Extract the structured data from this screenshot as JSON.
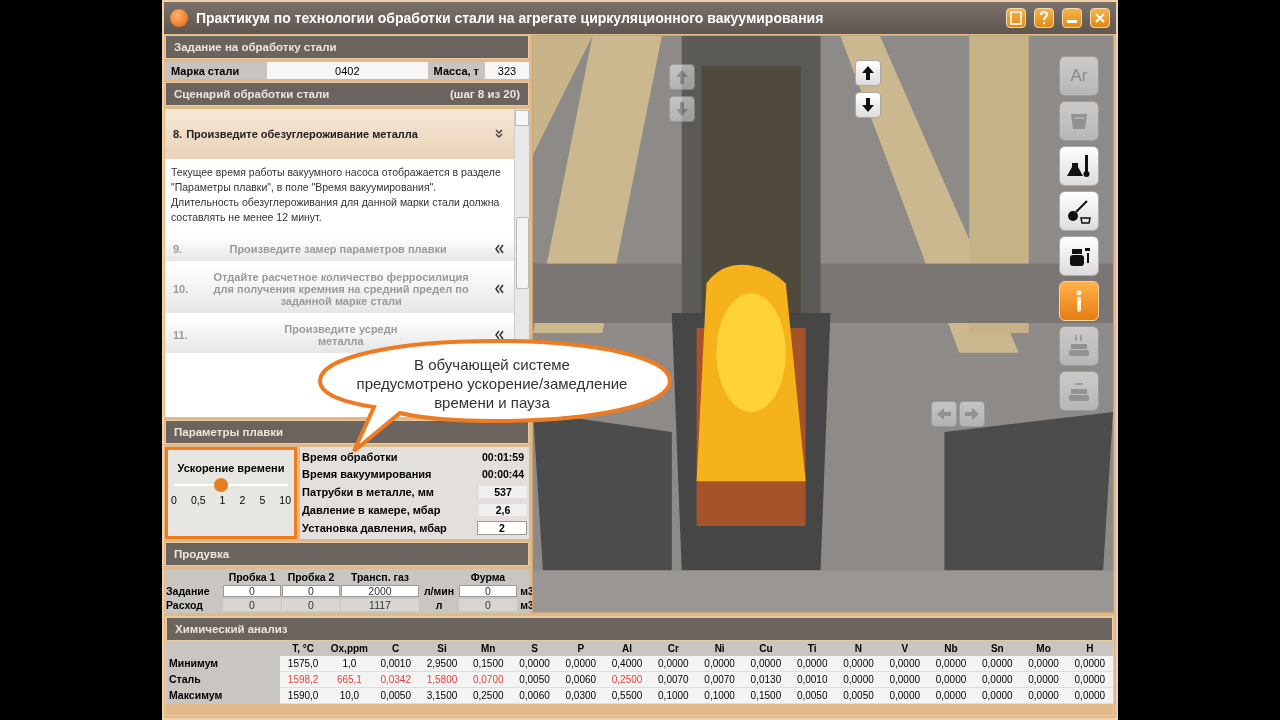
{
  "window": {
    "title": "Практикум по технологии обработки стали на агрегате циркуляционного вакуумирования"
  },
  "task": {
    "header": "Задание на обработку стали",
    "fields": [
      {
        "label": "Марка стали",
        "value": "0402"
      },
      {
        "label": "Масса, т",
        "value": "323"
      }
    ]
  },
  "scenario": {
    "header": "Сценарий обработки стали",
    "step_info": "(шаг 8 из 20)",
    "steps": [
      {
        "number": "8.",
        "lines": [
          "Произведите обезуглероживание металла"
        ],
        "expanded": true,
        "description": [
          "Текущее время работы вакуумного насоса отображается в разделе \"Параметры плавки\", в поле \"Время вакуумирования\".",
          "Длительность обезуглероживания для данной марки стали должна составлять не менее 12 минут."
        ]
      },
      {
        "number": "9.",
        "lines": [
          "Произведите замер параметров плавки"
        ],
        "expanded": false
      },
      {
        "number": "10.",
        "lines": [
          "Отдайте расчетное количество ферросилиция",
          "для получения кремния на средний предел по",
          "заданной марке стали"
        ],
        "expanded": false
      },
      {
        "number": "11.",
        "lines": [
          "Произведите усредн",
          "металла"
        ],
        "expanded": false
      }
    ]
  },
  "params": {
    "header": "Параметры плавки",
    "speed": {
      "label": "Ускорение времени",
      "ticks": [
        "0",
        "0,5",
        "1",
        "2",
        "5",
        "10"
      ],
      "level": 0.4,
      "highlighted": true
    },
    "readings": [
      {
        "label": "Время обработки",
        "value": "00:01:59",
        "kind": "readout"
      },
      {
        "label": "Время вакуумирования",
        "value": "00:00:44",
        "kind": "readout"
      },
      {
        "label": "Патрубки в металле, мм",
        "value": "537",
        "kind": "box"
      },
      {
        "label": "Давление в камере, мбар",
        "value": "2,6",
        "kind": "box"
      },
      {
        "label": "Установка давления, мбар",
        "value": "2",
        "kind": "input"
      }
    ]
  },
  "blowing": {
    "header": "Продувка",
    "columns": [
      "Пробка 1",
      "Пробка 2",
      "Трансп. газ",
      "",
      "Фурма",
      ""
    ],
    "rows": [
      {
        "label": "Задание",
        "editable": true,
        "cells": [
          "0",
          "0",
          "2000",
          "л/мин",
          "0",
          "м3"
        ]
      },
      {
        "label": "Расход",
        "editable": false,
        "cells": [
          "0",
          "0",
          "1117",
          "л",
          "0",
          "м3"
        ]
      }
    ]
  },
  "viewport": {
    "kind": "picture",
    "tools": [
      {
        "kind": "text",
        "label": "Ar",
        "disabled": true,
        "selected": false
      },
      {
        "kind": "ladle",
        "disabled": true,
        "selected": false
      },
      {
        "kind": "flask",
        "disabled": false,
        "selected": false
      },
      {
        "kind": "shovel",
        "disabled": false,
        "selected": false
      },
      {
        "kind": "pump",
        "disabled": false,
        "selected": false
      },
      {
        "kind": "info",
        "disabled": false,
        "selected": true
      },
      {
        "kind": "ladle-up",
        "disabled": true,
        "selected": false
      },
      {
        "kind": "ladle-side",
        "disabled": true,
        "selected": false
      }
    ],
    "lift_left": [
      {
        "kind": "up",
        "disabled": true
      },
      {
        "kind": "down",
        "disabled": true
      }
    ],
    "lift_right": [
      {
        "kind": "up",
        "disabled": false
      },
      {
        "kind": "down",
        "disabled": false
      }
    ],
    "cart": [
      {
        "kind": "left",
        "disabled": true
      },
      {
        "kind": "right",
        "disabled": true
      }
    ]
  },
  "callout": {
    "lines": [
      "В обучающей системе",
      "предусмотрено ускорение/замедление",
      "времени и пауза"
    ]
  },
  "chemistry": {
    "header": "Химический анализ",
    "columns": [
      "T, °C",
      "Ox,ppm",
      "C",
      "Si",
      "Mn",
      "S",
      "P",
      "Al",
      "Cr",
      "Ni",
      "Cu",
      "Ti",
      "N",
      "V",
      "Nb",
      "Sn",
      "Mo",
      "H"
    ],
    "rows": [
      {
        "label": "Минимум",
        "values": [
          "1575,0",
          "1,0",
          "0,0010",
          "2,9500",
          "0,1500",
          "0,0000",
          "0,0000",
          "0,4000",
          "0,0000",
          "0,0000",
          "0,0000",
          "0,0000",
          "0,0000",
          "0,0000",
          "0,0000",
          "0,0000",
          "0,0000",
          "0,0000"
        ],
        "alert": [
          false,
          false,
          false,
          false,
          false,
          false,
          false,
          false,
          false,
          false,
          false,
          false,
          false,
          false,
          false,
          false,
          false,
          false
        ]
      },
      {
        "label": "Сталь",
        "values": [
          "1598,2",
          "665,1",
          "0,0342",
          "1,5800",
          "0,0700",
          "0,0050",
          "0,0060",
          "0,2500",
          "0,0070",
          "0,0070",
          "0,0130",
          "0,0010",
          "0,0000",
          "0,0000",
          "0,0000",
          "0,0000",
          "0,0000",
          "0,0000"
        ],
        "alert": [
          true,
          true,
          true,
          true,
          true,
          false,
          false,
          true,
          false,
          false,
          false,
          false,
          false,
          false,
          false,
          false,
          false,
          false
        ]
      },
      {
        "label": "Максимум",
        "values": [
          "1590,0",
          "10,0",
          "0,0050",
          "3,1500",
          "0,2500",
          "0,0060",
          "0,0300",
          "0,5500",
          "0,1000",
          "0,1000",
          "0,1500",
          "0,0050",
          "0,0050",
          "0,0000",
          "0,0000",
          "0,0000",
          "0,0000",
          "0,0000"
        ],
        "alert": [
          false,
          false,
          false,
          false,
          false,
          false,
          false,
          false,
          false,
          false,
          false,
          false,
          false,
          false,
          false,
          false,
          false,
          false
        ]
      }
    ]
  }
}
